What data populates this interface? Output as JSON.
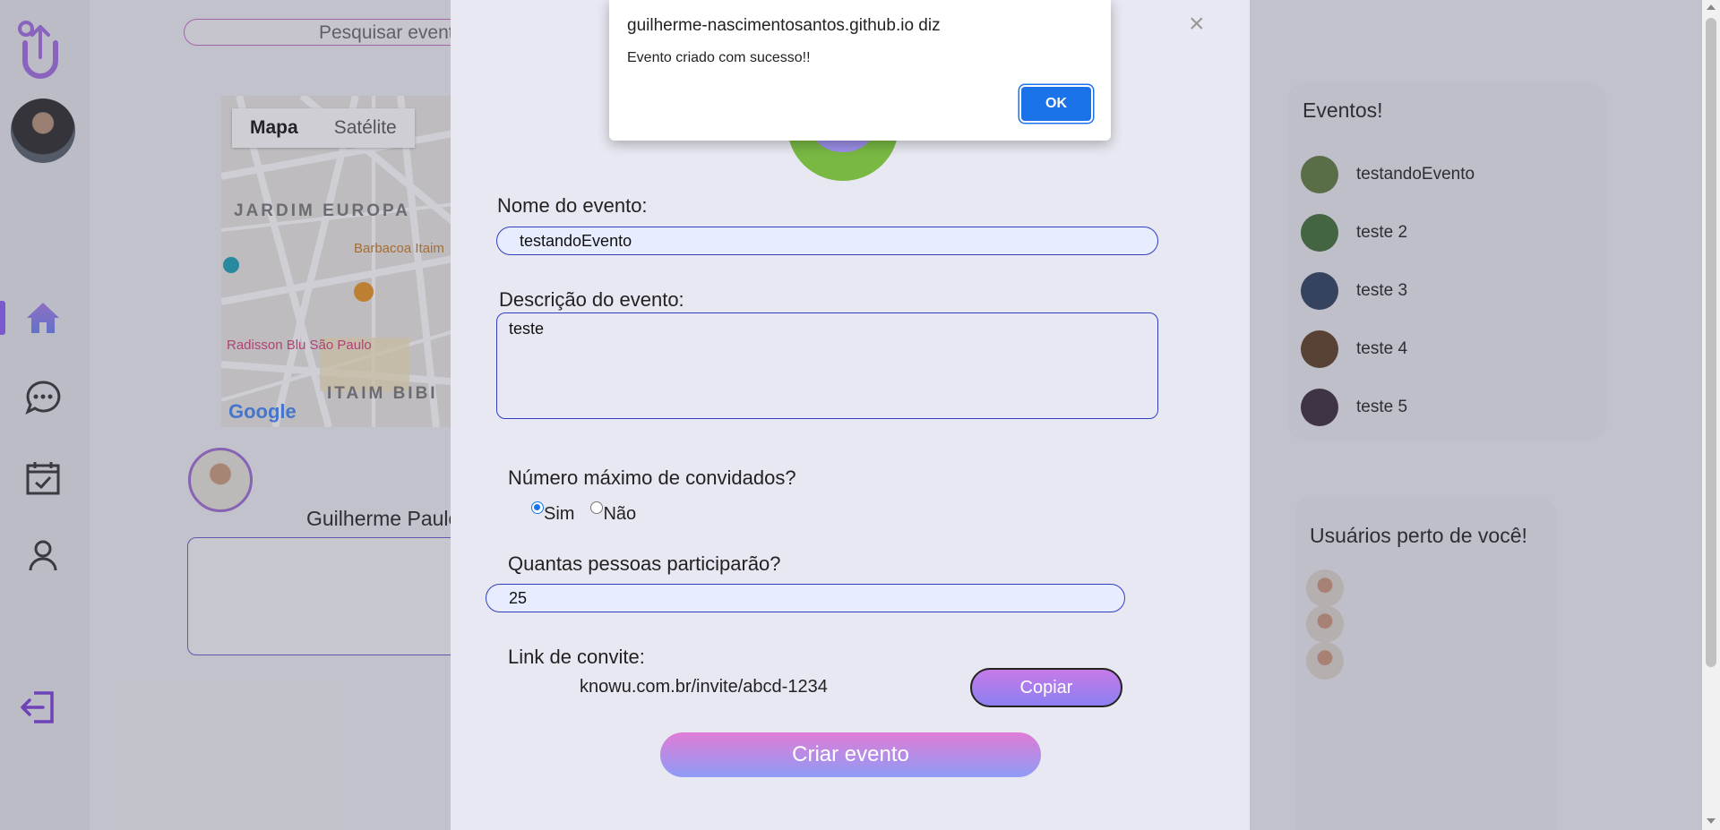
{
  "app": {
    "logo_name": "knowu-logo"
  },
  "search": {
    "value": "Pesquisar eventos"
  },
  "map": {
    "tabs": [
      "Mapa",
      "Satélite"
    ],
    "active_tab": "Mapa",
    "labels": [
      "JARDIM EUROPA",
      "ITAIM BIBI"
    ],
    "pois": [
      "Barbacoa Itaim",
      "Radisson Blu São Paulo"
    ],
    "attribution": "Google"
  },
  "profile": {
    "name": "Guilherme Paulo"
  },
  "events_panel": {
    "title": "Eventos!",
    "items": [
      {
        "name": "testandoEvento",
        "thumb_color": "#5e7a3c"
      },
      {
        "name": "teste 2",
        "thumb_color": "#3f6e35"
      },
      {
        "name": "teste 3",
        "thumb_color": "#2b3f5c"
      },
      {
        "name": "teste 4",
        "thumb_color": "#5c3e24"
      },
      {
        "name": "teste 5",
        "thumb_color": "#3a2a3a"
      }
    ]
  },
  "users_panel": {
    "title": "Usuários perto de você!"
  },
  "modal": {
    "close_label": "×",
    "name_label": "Nome do evento:",
    "name_value": "testandoEvento",
    "description_label": "Descrição do evento:",
    "description_value": "teste",
    "max_guests_label": "Número máximo de convidados?",
    "radio_yes": "Sim",
    "radio_no": "Não",
    "selected": "Sim",
    "participants_label": "Quantas pessoas participarão?",
    "participants_value": "25",
    "invite_label": "Link de convite:",
    "invite_link": "knowu.com.br/invite/abcd-1234",
    "copy_button": "Copiar",
    "create_button": "Criar evento"
  },
  "alert": {
    "title": "guilherme-nascimentosantos.github.io diz",
    "message": "Evento criado com sucesso!!",
    "ok_button": "OK"
  },
  "colors": {
    "accent": "#8b5cf6",
    "input_border": "#2f3fbf",
    "alert_button": "#1a73e8"
  }
}
